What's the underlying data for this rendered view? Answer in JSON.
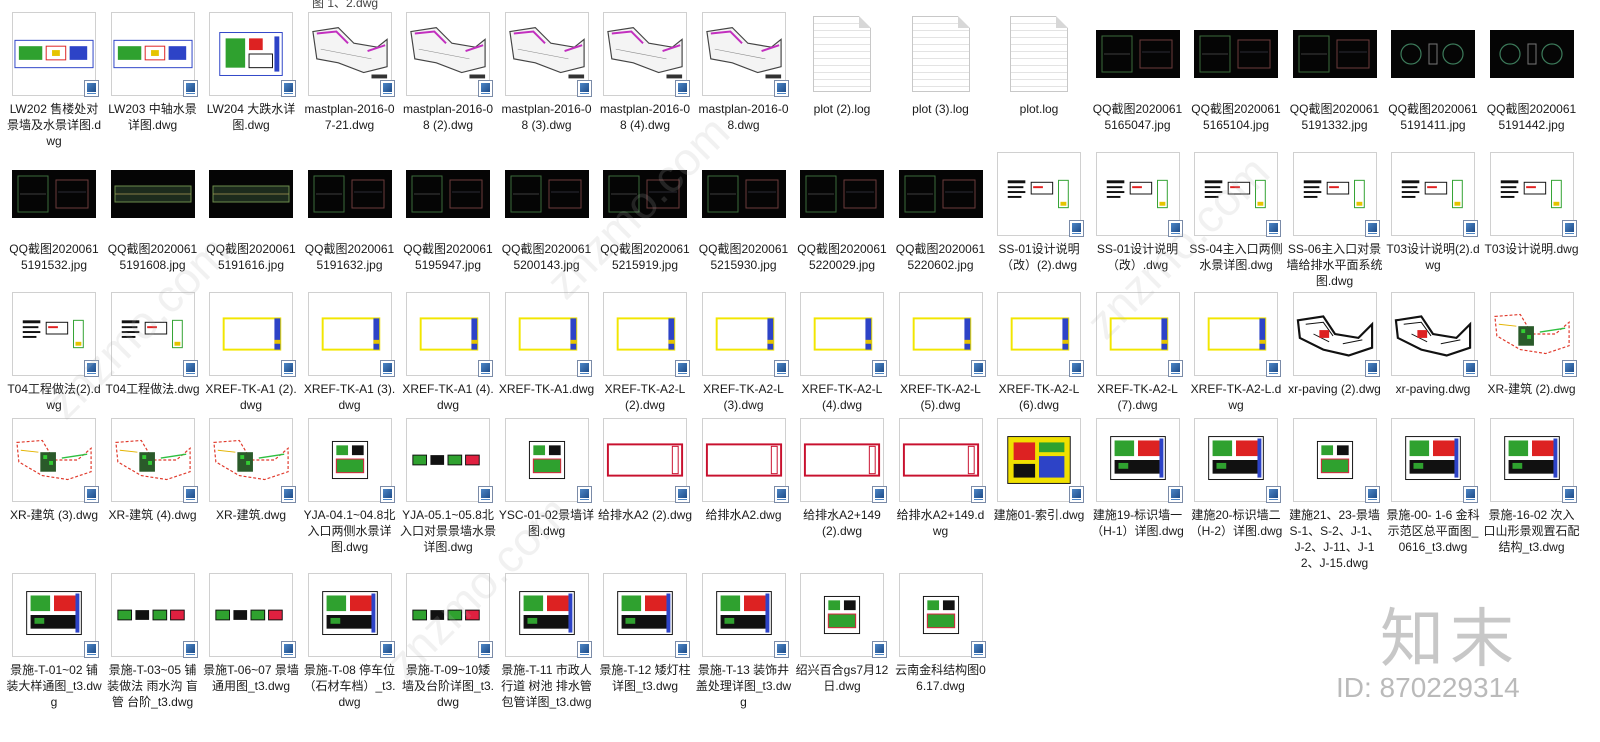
{
  "top_partial_label": "图 1、2.dwg",
  "watermark": {
    "logo": "知末",
    "id": "ID: 870229314",
    "site": "znzmo.com"
  },
  "files": [
    {
      "name": "LW202 售楼处对景墙及水景详图.dwg",
      "kind": "dwg",
      "style": "plan-multi"
    },
    {
      "name": "LW203 中轴水景详图.dwg",
      "kind": "dwg",
      "style": "plan-multi"
    },
    {
      "name": "LW204 大跌水详图.dwg",
      "kind": "dwg",
      "style": "plan-green"
    },
    {
      "name": "mastplan-2016-07-21.dwg",
      "kind": "dwg",
      "style": "mast"
    },
    {
      "name": "mastplan-2016-08 (2).dwg",
      "kind": "dwg",
      "style": "mast"
    },
    {
      "name": "mastplan-2016-08 (3).dwg",
      "kind": "dwg",
      "style": "mast"
    },
    {
      "name": "mastplan-2016-08 (4).dwg",
      "kind": "dwg",
      "style": "mast"
    },
    {
      "name": "mastplan-2016-08.dwg",
      "kind": "dwg",
      "style": "mast"
    },
    {
      "name": "plot (2).log",
      "kind": "log",
      "style": "log"
    },
    {
      "name": "plot (3).log",
      "kind": "log",
      "style": "log"
    },
    {
      "name": "plot.log",
      "kind": "log",
      "style": "log"
    },
    {
      "name": "QQ截图20200615165047.jpg",
      "kind": "jpg",
      "style": "dark"
    },
    {
      "name": "QQ截图20200615165104.jpg",
      "kind": "jpg",
      "style": "dark"
    },
    {
      "name": "QQ截图20200615191332.jpg",
      "kind": "jpg",
      "style": "dark"
    },
    {
      "name": "QQ截图20200615191411.jpg",
      "kind": "jpg",
      "style": "dark-round"
    },
    {
      "name": "QQ截图20200615191442.jpg",
      "kind": "jpg",
      "style": "dark-round"
    },
    {
      "name": "QQ截图20200615191532.jpg",
      "kind": "jpg",
      "style": "dark"
    },
    {
      "name": "QQ截图20200615191608.jpg",
      "kind": "jpg",
      "style": "dark-elev"
    },
    {
      "name": "QQ截图20200615191616.jpg",
      "kind": "jpg",
      "style": "dark-elev"
    },
    {
      "name": "QQ截图20200615191632.jpg",
      "kind": "jpg",
      "style": "dark"
    },
    {
      "name": "QQ截图20200615195947.jpg",
      "kind": "jpg",
      "style": "dark"
    },
    {
      "name": "QQ截图20200615200143.jpg",
      "kind": "jpg",
      "style": "dark"
    },
    {
      "name": "QQ截图20200615215919.jpg",
      "kind": "jpg",
      "style": "dark"
    },
    {
      "name": "QQ截图20200615215930.jpg",
      "kind": "jpg",
      "style": "dark"
    },
    {
      "name": "QQ截图20200615220029.jpg",
      "kind": "jpg",
      "style": "dark"
    },
    {
      "name": "QQ截图20200615220602.jpg",
      "kind": "jpg",
      "style": "dark"
    },
    {
      "name": "SS-01设计说明（改）(2).dwg",
      "kind": "dwg",
      "style": "text-sheet"
    },
    {
      "name": "SS-01设计说明（改）.dwg",
      "kind": "dwg",
      "style": "text-sheet"
    },
    {
      "name": "SS-04主入口两侧水景详图.dwg",
      "kind": "dwg",
      "style": "text-sheet"
    },
    {
      "name": "SS-06主入口对景墙给排水平面系统图.dwg",
      "kind": "dwg",
      "style": "text-sheet"
    },
    {
      "name": "T03设计说明(2).dwg",
      "kind": "dwg",
      "style": "text-sheet"
    },
    {
      "name": "T03设计说明.dwg",
      "kind": "dwg",
      "style": "text-sheet"
    },
    {
      "name": "T04工程做法(2).dwg",
      "kind": "dwg",
      "style": "text-sheet"
    },
    {
      "name": "T04工程做法.dwg",
      "kind": "dwg",
      "style": "text-sheet"
    },
    {
      "name": "XREF-TK-A1 (2).dwg",
      "kind": "dwg",
      "style": "frame-yellow"
    },
    {
      "name": "XREF-TK-A1 (3).dwg",
      "kind": "dwg",
      "style": "frame-yellow"
    },
    {
      "name": "XREF-TK-A1 (4).dwg",
      "kind": "dwg",
      "style": "frame-yellow"
    },
    {
      "name": "XREF-TK-A1.dwg",
      "kind": "dwg",
      "style": "frame-yellow"
    },
    {
      "name": "XREF-TK-A2-L (2).dwg",
      "kind": "dwg",
      "style": "frame-yellow"
    },
    {
      "name": "XREF-TK-A2-L (3).dwg",
      "kind": "dwg",
      "style": "frame-yellow"
    },
    {
      "name": "XREF-TK-A2-L (4).dwg",
      "kind": "dwg",
      "style": "frame-yellow"
    },
    {
      "name": "XREF-TK-A2-L (5).dwg",
      "kind": "dwg",
      "style": "frame-yellow"
    },
    {
      "name": "XREF-TK-A2-L (6).dwg",
      "kind": "dwg",
      "style": "frame-yellow"
    },
    {
      "name": "XREF-TK-A2-L (7).dwg",
      "kind": "dwg",
      "style": "frame-yellow"
    },
    {
      "name": "XREF-TK-A2-L.dwg",
      "kind": "dwg",
      "style": "frame-yellow"
    },
    {
      "name": "xr-paving (2).dwg",
      "kind": "dwg",
      "style": "paving"
    },
    {
      "name": "xr-paving.dwg",
      "kind": "dwg",
      "style": "paving"
    },
    {
      "name": "XR-建筑 (2).dwg",
      "kind": "dwg",
      "style": "site"
    },
    {
      "name": "XR-建筑 (3).dwg",
      "kind": "dwg",
      "style": "site"
    },
    {
      "name": "XR-建筑 (4).dwg",
      "kind": "dwg",
      "style": "site"
    },
    {
      "name": "XR-建筑.dwg",
      "kind": "dwg",
      "style": "site"
    },
    {
      "name": "YJA-04.1~04.8北入口两侧水景详图.dwg",
      "kind": "dwg",
      "style": "detail-small"
    },
    {
      "name": "YJA-05.1~05.8北入口对景景墙水景详图.dwg",
      "kind": "dwg",
      "style": "strip"
    },
    {
      "name": "YSC-01-02景墙详图.dwg",
      "kind": "dwg",
      "style": "detail-small"
    },
    {
      "name": "给排水A2 (2).dwg",
      "kind": "dwg",
      "style": "frame-red"
    },
    {
      "name": "给排水A2.dwg",
      "kind": "dwg",
      "style": "frame-red"
    },
    {
      "name": "给排水A2+149 (2).dwg",
      "kind": "dwg",
      "style": "frame-red"
    },
    {
      "name": "给排水A2+149.dwg",
      "kind": "dwg",
      "style": "frame-red"
    },
    {
      "name": "建施01-索引.dwg",
      "kind": "dwg",
      "style": "index"
    },
    {
      "name": "建施19-标识墙一（H-1）详图.dwg",
      "kind": "dwg",
      "style": "detail"
    },
    {
      "name": "建施20-标识墙二（H-2）详图.dwg",
      "kind": "dwg",
      "style": "detail"
    },
    {
      "name": "建施21、23-景墙S-1、S-2、J-1、J-2、J-11、J-12、J-15.dwg",
      "kind": "dwg",
      "style": "detail-small"
    },
    {
      "name": "景施-00- 1-6 金科示范区总平面图_0616_t3.dwg",
      "kind": "dwg",
      "style": "detail"
    },
    {
      "name": "景施-16-02 次入口山形景观置石配结构_t3.dwg",
      "kind": "dwg",
      "style": "detail"
    },
    {
      "name": "景施-T-01~02 铺装大样通图_t3.dwg",
      "kind": "dwg",
      "style": "detail"
    },
    {
      "name": "景施-T-03~05 铺装做法 雨水沟 盲管 台阶_t3.dwg",
      "kind": "dwg",
      "style": "strip"
    },
    {
      "name": "景施T-06~07 景墙通用图_t3.dwg",
      "kind": "dwg",
      "style": "strip"
    },
    {
      "name": "景施-T-08 停车位（石材车档）_t3.dwg",
      "kind": "dwg",
      "style": "detail"
    },
    {
      "name": "景施-T-09~10矮墙及台阶详图_t3.dwg",
      "kind": "dwg",
      "style": "strip"
    },
    {
      "name": "景施-T-11 市政人行道 树池 排水管包管详图_t3.dwg",
      "kind": "dwg",
      "style": "detail"
    },
    {
      "name": "景施-T-12 矮灯柱详图_t3.dwg",
      "kind": "dwg",
      "style": "detail"
    },
    {
      "name": "景施-T-13 装饰井盖处理详图_t3.dwg",
      "kind": "dwg",
      "style": "detail"
    },
    {
      "name": "绍兴百合gs7月12日.dwg",
      "kind": "dwg",
      "style": "detail-small"
    },
    {
      "name": "云南金科结构图06.17.dwg",
      "kind": "dwg",
      "style": "detail-small"
    }
  ]
}
